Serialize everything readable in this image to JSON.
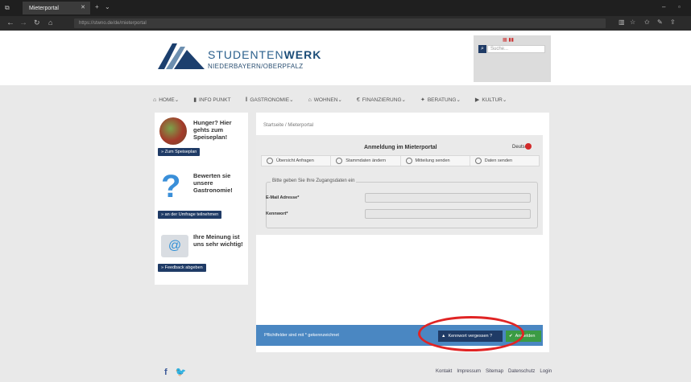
{
  "browser": {
    "tab_title": "Mieterportal",
    "url": "https://stwno.de/de/mieterportal"
  },
  "header": {
    "logo_main": "STUDENTEN",
    "logo_bold": "WERK",
    "logo_sub": "NIEDERBAYERN/OBERPFALZ",
    "search_placeholder": "Suche..."
  },
  "nav": {
    "items": [
      {
        "label": "HOME",
        "icon": "home-icon"
      },
      {
        "label": "INFO PUNKT",
        "icon": "info-icon"
      },
      {
        "label": "GASTRONOMIE",
        "icon": "cutlery-icon"
      },
      {
        "label": "WOHNEN",
        "icon": "house-icon"
      },
      {
        "label": "FINANZIERUNG",
        "icon": "euro-icon"
      },
      {
        "label": "BERATUNG",
        "icon": "lightbulb-icon"
      },
      {
        "label": "KULTUR",
        "icon": "culture-icon"
      }
    ]
  },
  "promo": {
    "p1_title": "Hunger? Hier gehts zum Speiseplan!",
    "p1_btn": "» Zum Speiseplan",
    "p2_title": "Bewerten sie unsere Gastronomie!",
    "p2_btn": "» an der Umfrage teilnehmen",
    "p3_title": "Ihre Meinung ist uns sehr wichtig!",
    "p3_btn": "» Feedback abgeben"
  },
  "main": {
    "breadcrumb": "Startseite / Mieterportal",
    "title": "Anmeldung im Mieterportal",
    "language": "Deutsch",
    "tabs": [
      "Übersicht Anfragen",
      "Stammdaten ändern",
      "Mitteilung senden",
      "Daten senden"
    ],
    "legend": "Bitte geben Sie Ihre Zugangsdaten ein",
    "email_label": "E-Mail Adresse*",
    "password_label": "Kennwort*",
    "required_note": "Pflichtfelder sind mit * gekennzeichnet",
    "forgot_label": "Kennwort vergessen ?",
    "login_label": "Anmelden"
  },
  "footer": {
    "links": [
      "Kontakt",
      "Impressum",
      "Sitemap",
      "Datenschutz",
      "Login"
    ]
  }
}
